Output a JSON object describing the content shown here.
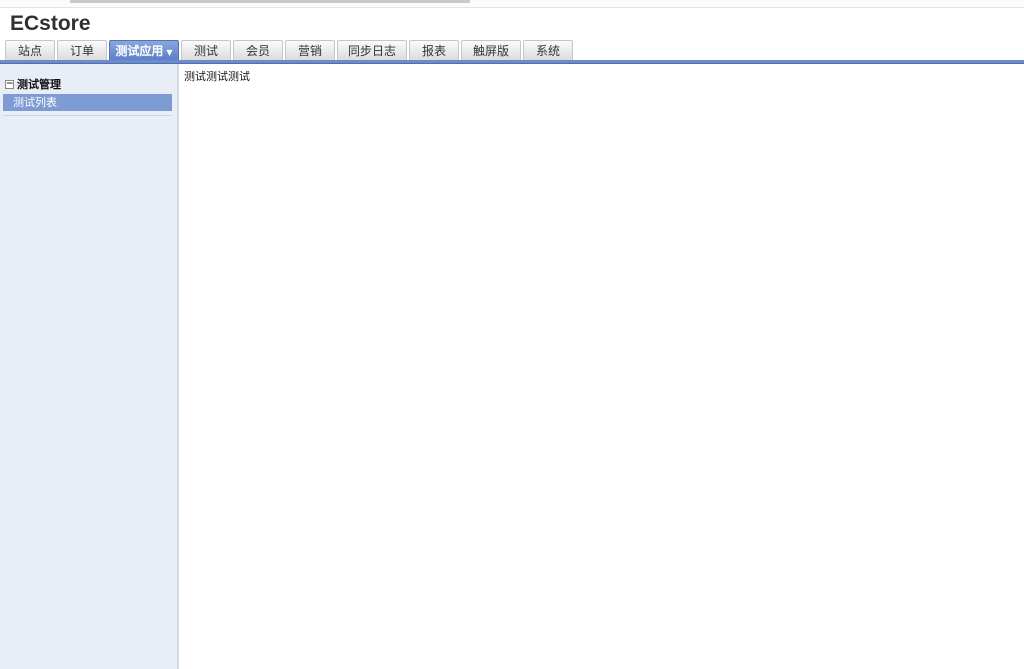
{
  "app": {
    "logo": "ECstore"
  },
  "nav": {
    "tabs": [
      {
        "label": "站点"
      },
      {
        "label": "订单"
      },
      {
        "label": "测试应用",
        "active": true
      },
      {
        "label": "测试"
      },
      {
        "label": "会员"
      },
      {
        "label": "营销"
      },
      {
        "label": "同步日志"
      },
      {
        "label": "报表"
      },
      {
        "label": "触屏版"
      },
      {
        "label": "系统"
      }
    ]
  },
  "sidebar": {
    "group_title": "测试管理",
    "items": [
      {
        "label": "测试列表",
        "selected": true
      }
    ]
  },
  "main": {
    "text": "测试测试测试"
  },
  "colors": {
    "accent": "#6d8bc9",
    "active_tab": "#5b80c8",
    "sidebar_bg": "#e9edf6",
    "selected_item": "#7f9bd3"
  }
}
